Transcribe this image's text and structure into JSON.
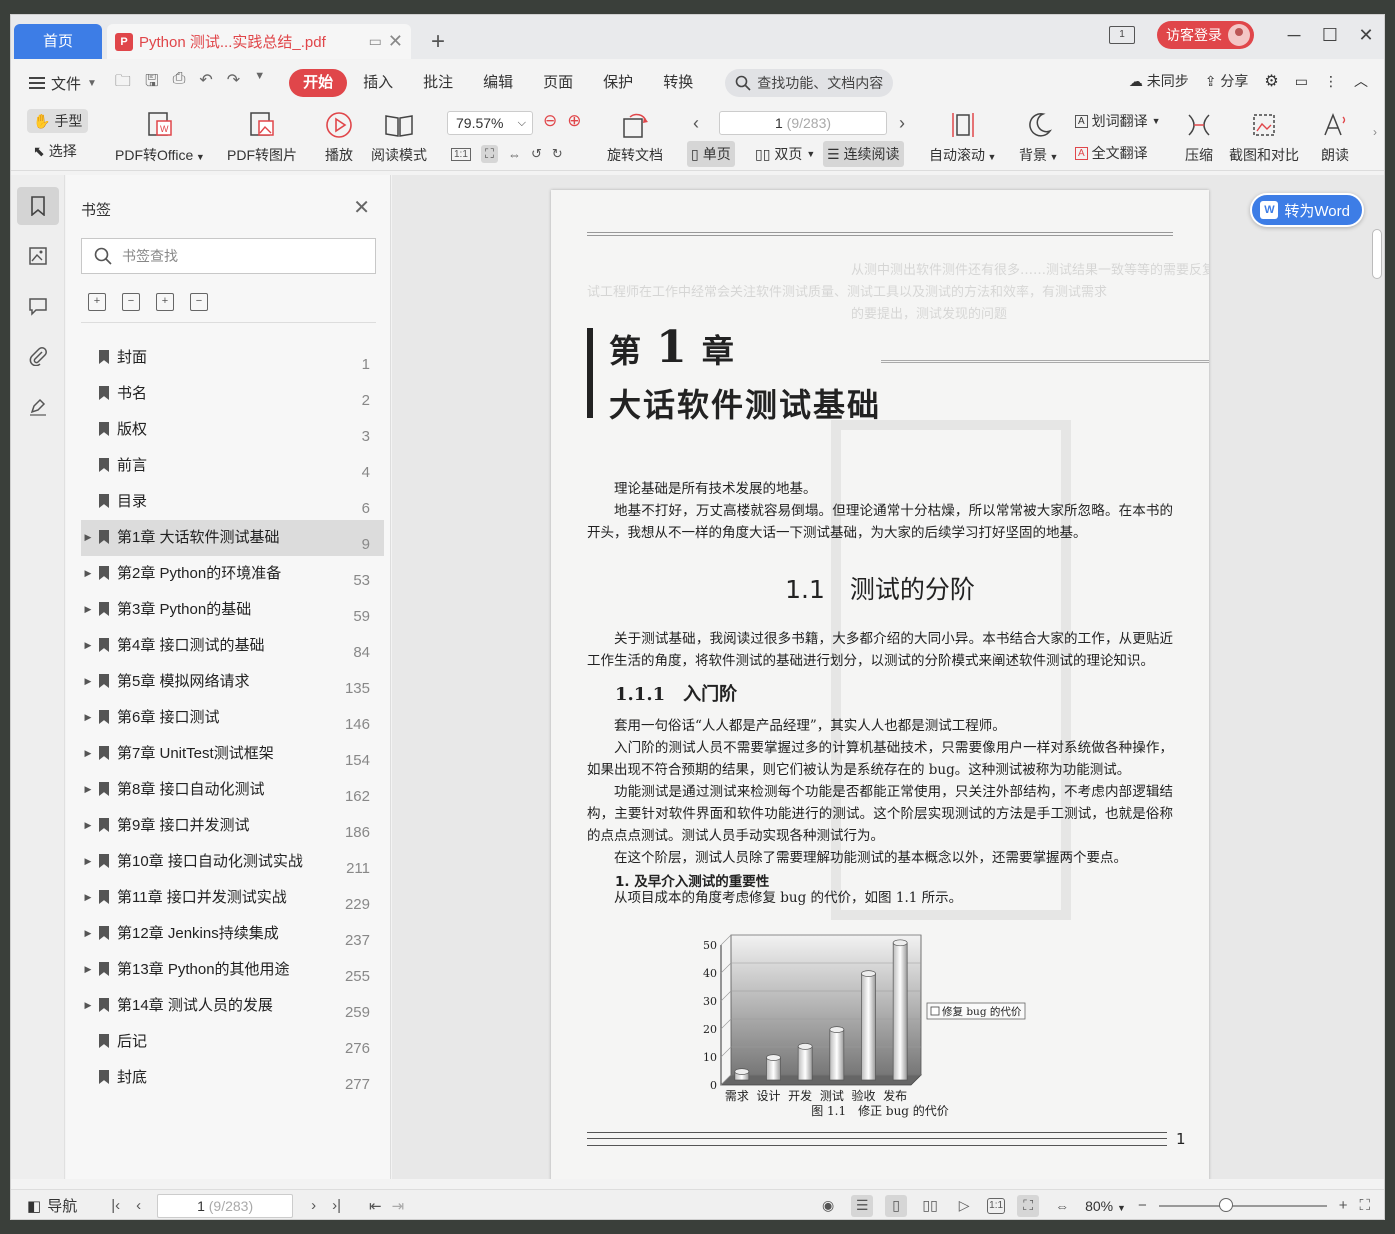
{
  "titlebar": {
    "home_tab": "首页",
    "doc_tab_title": "Python 测试...实践总结_.pdf",
    "login": "访客登录"
  },
  "menubar": {
    "file": "文件",
    "tabs": [
      "开始",
      "插入",
      "批注",
      "编辑",
      "页面",
      "保护",
      "转换"
    ],
    "active_tab": "开始",
    "search_func": "查找功能、文档内容",
    "sync": "未同步",
    "share": "分享"
  },
  "ribbon": {
    "hand": "手型",
    "select": "选择",
    "pdf_to_office": "PDF转Office",
    "pdf_to_image": "PDF转图片",
    "play": "播放",
    "read_mode": "阅读模式",
    "zoom": "79.57%",
    "rotate": "旋转文档",
    "page_current": "1",
    "page_total": "(9/283)",
    "single": "单页",
    "double": "双页",
    "continuous": "连续阅读",
    "auto_scroll": "自动滚动",
    "background": "背景",
    "word_translate": "划词翻译",
    "full_translate": "全文翻译",
    "compress": "压缩",
    "screenshot": "截图和对比",
    "read_aloud": "朗读"
  },
  "bookmarks": {
    "title": "书签",
    "search_placeholder": "书签查找",
    "items": [
      {
        "label": "封面",
        "page": "1",
        "expandable": false
      },
      {
        "label": "书名",
        "page": "2",
        "expandable": false
      },
      {
        "label": "版权",
        "page": "3",
        "expandable": false
      },
      {
        "label": "前言",
        "page": "4",
        "expandable": false
      },
      {
        "label": "目录",
        "page": "6",
        "expandable": false
      },
      {
        "label": "第1章  大话软件测试基础",
        "page": "9",
        "expandable": true,
        "selected": true
      },
      {
        "label": "第2章  Python的环境准备",
        "page": "53",
        "expandable": true
      },
      {
        "label": "第3章  Python的基础",
        "page": "59",
        "expandable": true
      },
      {
        "label": "第4章  接口测试的基础",
        "page": "84",
        "expandable": true
      },
      {
        "label": "第5章  模拟网络请求",
        "page": "135",
        "expandable": true
      },
      {
        "label": "第6章  接口测试",
        "page": "146",
        "expandable": true
      },
      {
        "label": "第7章  UnitTest测试框架",
        "page": "154",
        "expandable": true
      },
      {
        "label": "第8章  接口自动化测试",
        "page": "162",
        "expandable": true
      },
      {
        "label": "第9章  接口并发测试",
        "page": "186",
        "expandable": true
      },
      {
        "label": "第10章  接口自动化测试实战",
        "page": "211",
        "expandable": true
      },
      {
        "label": "第11章  接口并发测试实战",
        "page": "229",
        "expandable": true
      },
      {
        "label": "第12章  Jenkins持续集成",
        "page": "237",
        "expandable": true
      },
      {
        "label": "第13章  Python的其他用途",
        "page": "255",
        "expandable": true
      },
      {
        "label": "第14章  测试人员的发展",
        "page": "259",
        "expandable": true
      },
      {
        "label": "后记",
        "page": "276",
        "expandable": false
      },
      {
        "label": "封底",
        "page": "277",
        "expandable": false
      }
    ]
  },
  "document": {
    "to_word": "转为Word",
    "chapter_prefix": "第",
    "chapter_num": "1",
    "chapter_suffix": "章",
    "chapter_title": "大话软件测试基础",
    "intro1": "理论基础是所有技术发展的地基。",
    "intro2": "地基不打好，万丈高楼就容易倒塌。但理论通常十分枯燥，所以常常被大家所忽略。在本书的开头，我想从不一样的角度大话一下测试基础，为大家的后续学习打好坚固的地基。",
    "section": "1.1　测试的分阶",
    "sec_para": "关于测试基础，我阅读过很多书籍，大多都介绍的大同小异。本书结合大家的工作，从更贴近工作生活的角度，将软件测试的基础进行划分，以测试的分阶模式来阐述软件测试的理论知识。",
    "subsection": "1.1.1　入门阶",
    "p1": "套用一句俗话“人人都是产品经理”，其实人人也都是测试工程师。",
    "p2": "入门阶的测试人员不需要掌握过多的计算机基础技术，只需要像用户一样对系统做各种操作，如果出现不符合预期的结果，则它们被认为是系统存在的 bug。这种测试被称为功能测试。",
    "p3": "功能测试是通过测试来检测每个功能是否都能正常使用，只关注外部结构，不考虑内部逻辑结构，主要针对软件界面和软件功能进行的测试。这个阶层实现测试的方法是手工测试，也就是俗称的点点点测试。测试人员手动实现各种测试行为。",
    "p4": "在这个阶层，测试人员除了需要理解功能测试的基本概念以外，还需要掌握两个要点。",
    "point1": "1.  及早介入测试的重要性",
    "p5": "从项目成本的角度考虑修复 bug 的代价，如图 1.1 所示。",
    "fig_caption": "图 1.1　修正 bug 的代价",
    "page_number": "1"
  },
  "chart_data": {
    "type": "bar",
    "categories": [
      "需求",
      "设计",
      "开发",
      "测试",
      "验收",
      "发布"
    ],
    "series": [
      {
        "name": "修复 bug 的代价",
        "values": [
          3,
          8,
          12,
          18,
          38,
          49
        ]
      }
    ],
    "ylim": [
      0,
      50
    ],
    "yticks": [
      "0",
      "10",
      "20",
      "30",
      "40",
      "50"
    ],
    "title": "",
    "xlabel": "",
    "ylabel": ""
  },
  "statusbar": {
    "nav": "导航",
    "page_current": "1",
    "page_total": "(9/283)",
    "zoom": "80%"
  }
}
